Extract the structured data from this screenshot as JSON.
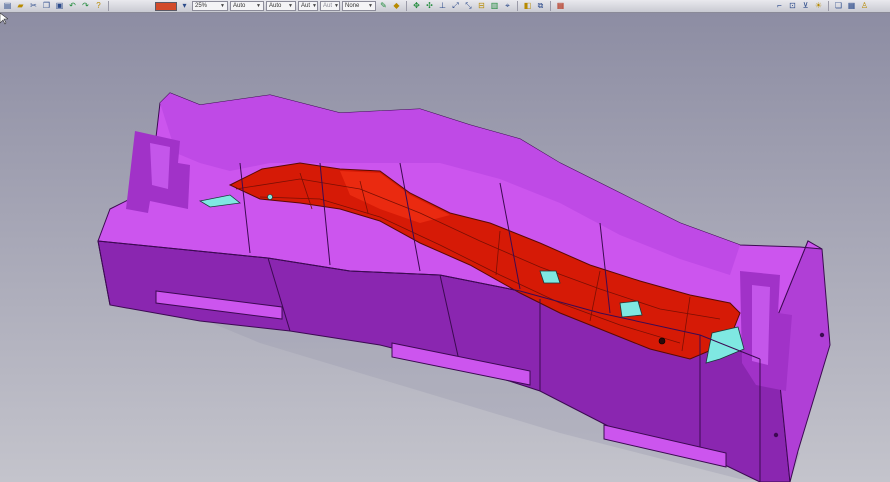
{
  "toolbar": {
    "zoom_value": "25%",
    "field_2": "Auto",
    "field_3": "Auto",
    "field_4": "Aut",
    "field_5": "Aut",
    "field_6": "None",
    "color_swatch": "#d24a2a"
  },
  "icons": [
    "new-icon",
    "open-icon",
    "cut-icon",
    "copy-icon",
    "paste-icon",
    "undo-icon",
    "redo-icon",
    "help-icon",
    "move-icon",
    "rotate-icon",
    "pan-icon",
    "zoom-icon",
    "fit-icon",
    "view-icon",
    "render-icon",
    "layers-icon",
    "grid-icon",
    "print-icon"
  ],
  "colors": {
    "mold_body": "#b03fd6",
    "mold_top": "#cc55ee",
    "mold_side": "#8a26b0",
    "cavity": "#d61a06",
    "insert": "#7fe8e2",
    "background_top": "#8d8da3",
    "background_bottom": "#c4c4cc"
  }
}
